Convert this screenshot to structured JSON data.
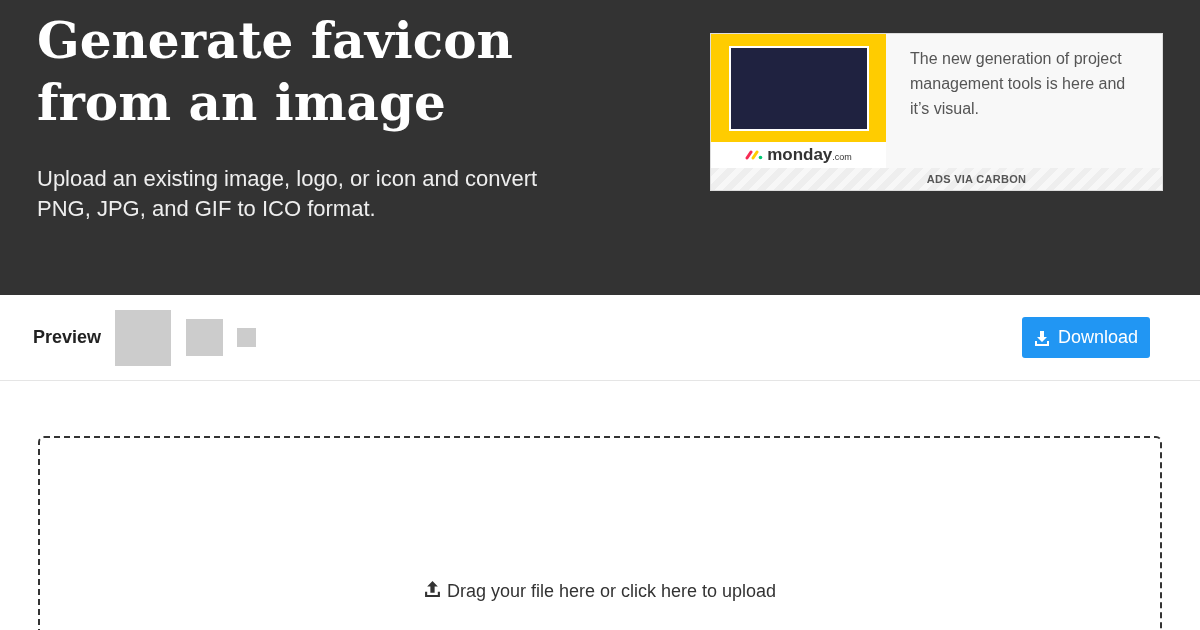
{
  "hero": {
    "title_lines": [
      "Generate favicon",
      "from an image"
    ],
    "subtitle": "Upload an existing image, logo, or icon and convert PNG, JPG, and GIF to ICO format."
  },
  "ad": {
    "logo": "monday",
    "logo_suffix": ".com",
    "text": "The new generation of project management tools is here and it’s visual.",
    "footer": "ADS VIA CARBON"
  },
  "preview": {
    "label": "Preview",
    "download": "Download"
  },
  "upload": {
    "prompt": "Drag your file here or click here to upload"
  }
}
